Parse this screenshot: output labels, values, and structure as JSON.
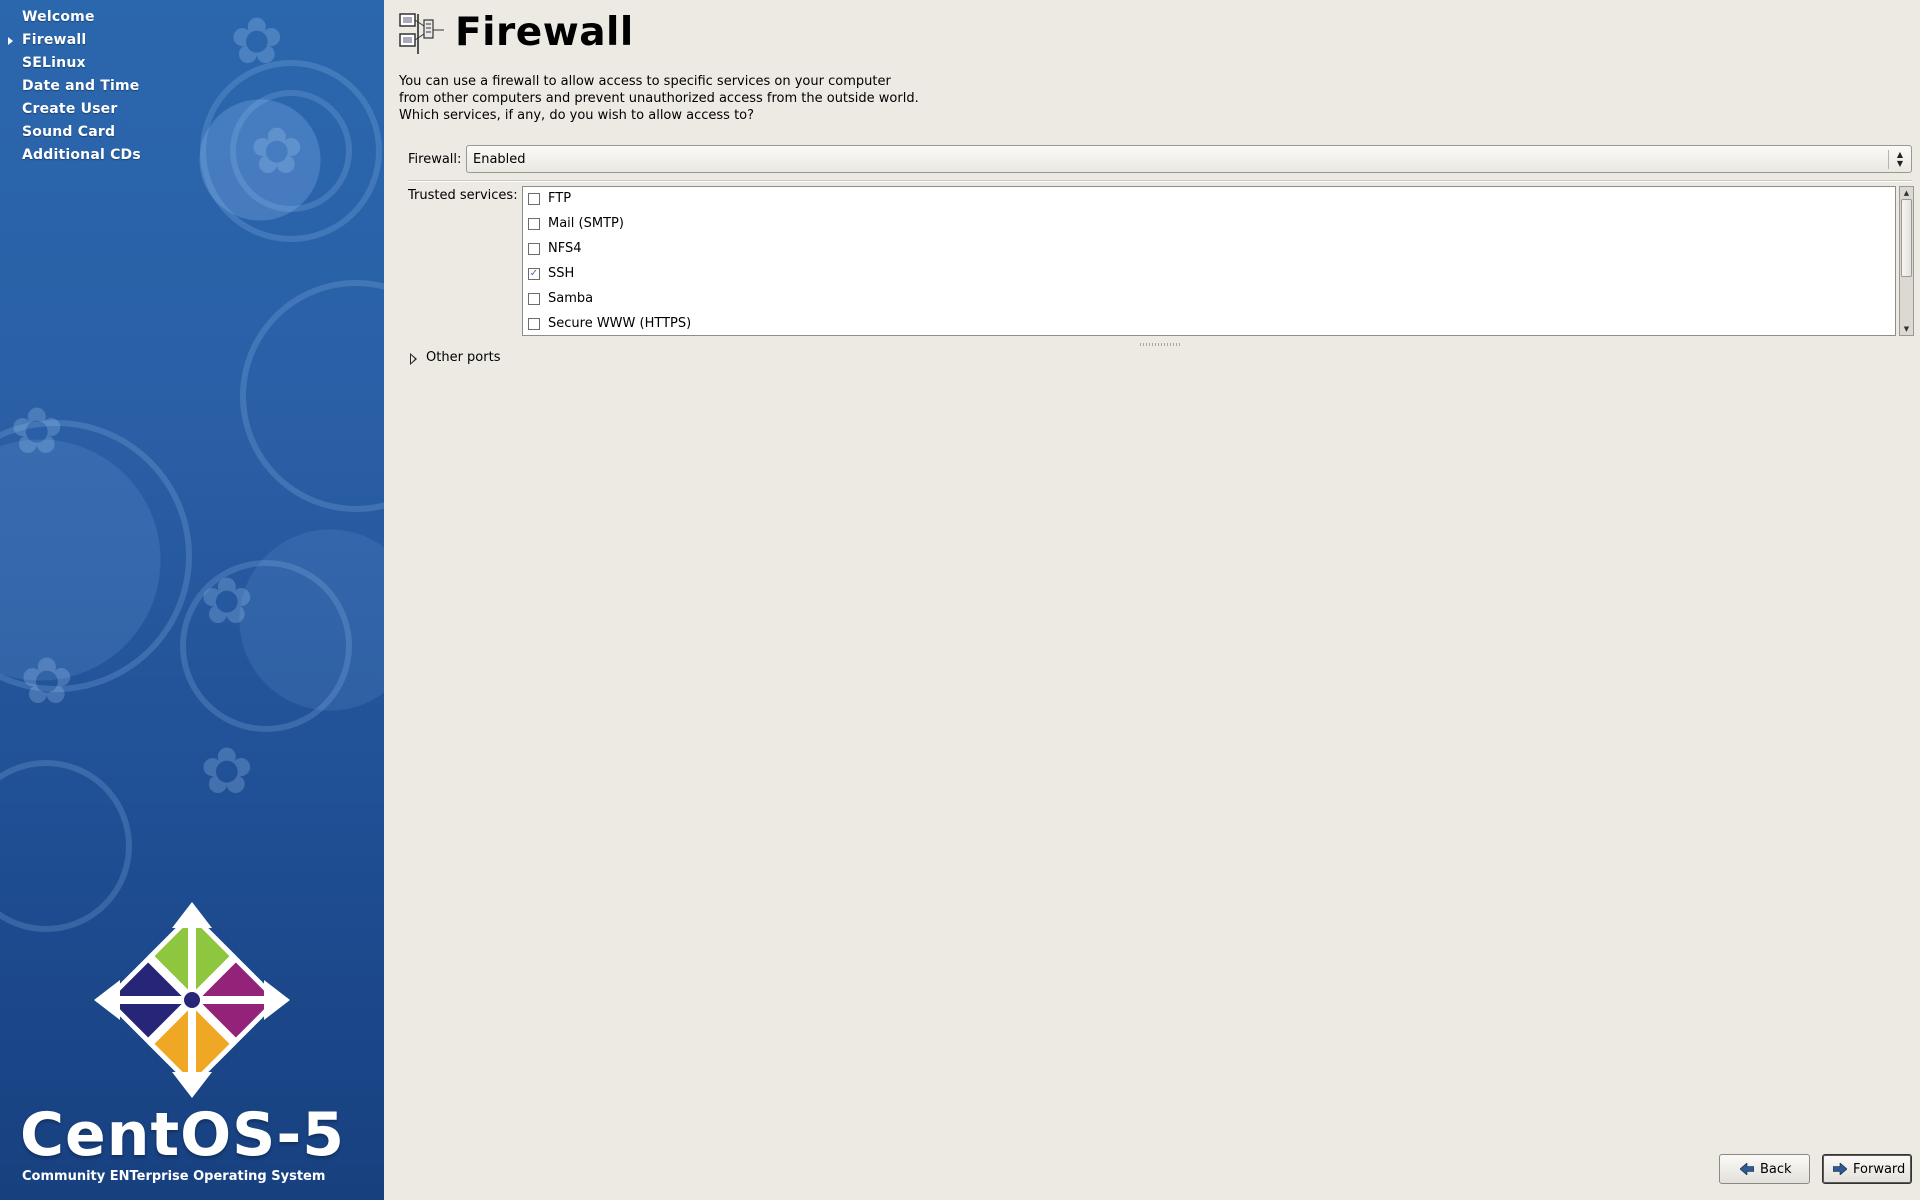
{
  "sidebar": {
    "items": [
      {
        "label": "Welcome",
        "current": false
      },
      {
        "label": "Firewall",
        "current": true
      },
      {
        "label": "SELinux",
        "current": false
      },
      {
        "label": "Date and Time",
        "current": false
      },
      {
        "label": "Create User",
        "current": false
      },
      {
        "label": "Sound Card",
        "current": false
      },
      {
        "label": "Additional CDs",
        "current": false
      }
    ],
    "brand": "CentOS-5",
    "brand_subtitle": "Community ENTerprise Operating System",
    "logo_colors": {
      "green": "#8ec63f",
      "purple": "#932279",
      "orange": "#efa724",
      "indigo": "#262577"
    }
  },
  "page": {
    "icon": "firewall-network-icon",
    "title": "Firewall",
    "description": "You can use a firewall to allow access to specific services on your computer from other computers and prevent unauthorized access from the outside world.  Which services, if any, do you wish to allow access to?"
  },
  "firewall": {
    "label": "Firewall:",
    "selected": "Enabled"
  },
  "trusted_services": {
    "label": "Trusted services:",
    "items": [
      {
        "name": "FTP",
        "checked": false
      },
      {
        "name": "Mail (SMTP)",
        "checked": false
      },
      {
        "name": "NFS4",
        "checked": false
      },
      {
        "name": "SSH",
        "checked": true
      },
      {
        "name": "Samba",
        "checked": false
      },
      {
        "name": "Secure WWW (HTTPS)",
        "checked": false
      }
    ]
  },
  "other_ports": {
    "label": "Other ports",
    "expanded": false
  },
  "buttons": {
    "back": "Back",
    "forward": "Forward"
  },
  "colors": {
    "sidebar_top": "#2b67ad",
    "sidebar_bottom": "#17407f",
    "background": "#edeae4",
    "check": "#3a6fb5"
  }
}
